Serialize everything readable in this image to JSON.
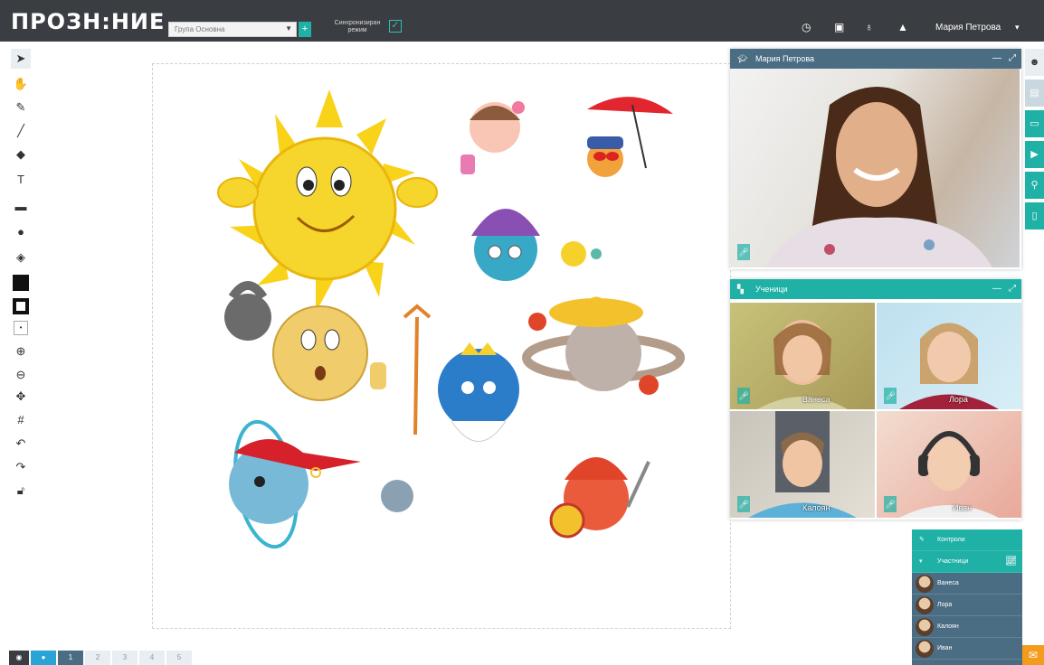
{
  "app": {
    "logo": "ПРОЗН:НИЕ"
  },
  "header": {
    "group_select": "Група Основна",
    "add_label": "+",
    "sync_label": "Синхронизиран режим",
    "user_name": "Мария Петрова"
  },
  "teacher_window": {
    "title": "Мария Петрова"
  },
  "students_window": {
    "title": "Ученици",
    "students": [
      "Ванеса",
      "Лора",
      "Калоян",
      "Иван"
    ]
  },
  "participants_panel": {
    "controls_label": "Контроли",
    "participants_label": "Участници",
    "people": [
      "Ванеса",
      "Лора",
      "Калоян",
      "Иван"
    ]
  },
  "pager": {
    "pages": [
      "1",
      "2",
      "3",
      "4",
      "5"
    ]
  },
  "colors": {
    "accent": "#1fb1a5",
    "header": "#3a3d42",
    "panel": "#4a6d84",
    "chat": "#f39b1c"
  }
}
